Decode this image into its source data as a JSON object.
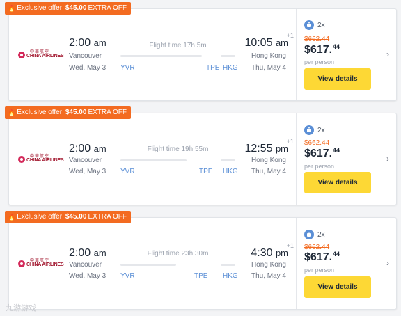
{
  "cards": [
    {
      "badge": {
        "prefix": "Exclusive offer!",
        "amount": "$45.00",
        "suffix": "EXTRA OFF"
      },
      "airline": {
        "name_en": "CHINA AIRLINES",
        "name_cn": "中華航空"
      },
      "depart": {
        "time": "2:00",
        "ampm": "am",
        "city": "Vancouver",
        "date": "Wed, May 3",
        "code": "YVR"
      },
      "flight_time": "Flight time 17h 5m",
      "stop_code": "TPE",
      "arrive": {
        "time": "10:05",
        "ampm": "am",
        "plus": "+1",
        "city": "Hong Kong",
        "date": "Thu, May 4",
        "code": "HKG"
      },
      "bags": "2x",
      "old_price": "$662.44",
      "price_main": "$617.",
      "price_cents": "44",
      "per": "per person",
      "button": "View details"
    },
    {
      "badge": {
        "prefix": "Exclusive offer!",
        "amount": "$45.00",
        "suffix": "EXTRA OFF"
      },
      "airline": {
        "name_en": "CHINA AIRLINES",
        "name_cn": "中華航空"
      },
      "depart": {
        "time": "2:00",
        "ampm": "am",
        "city": "Vancouver",
        "date": "Wed, May 3",
        "code": "YVR"
      },
      "flight_time": "Flight time 19h 55m",
      "stop_code": "TPE",
      "arrive": {
        "time": "12:55",
        "ampm": "pm",
        "plus": "+1",
        "city": "Hong Kong",
        "date": "Thu, May 4",
        "code": "HKG"
      },
      "bags": "2x",
      "old_price": "$662.44",
      "price_main": "$617.",
      "price_cents": "44",
      "per": "per person",
      "button": "View details"
    },
    {
      "badge": {
        "prefix": "Exclusive offer!",
        "amount": "$45.00",
        "suffix": "EXTRA OFF"
      },
      "airline": {
        "name_en": "CHINA AIRLINES",
        "name_cn": "中華航空"
      },
      "depart": {
        "time": "2:00",
        "ampm": "am",
        "city": "Vancouver",
        "date": "Wed, May 3",
        "code": "YVR"
      },
      "flight_time": "Flight time 23h 30m",
      "stop_code": "TPE",
      "arrive": {
        "time": "4:30",
        "ampm": "pm",
        "plus": "+1",
        "city": "Hong Kong",
        "date": "Thu, May 4",
        "code": "HKG"
      },
      "bags": "2x",
      "old_price": "$662.44",
      "price_main": "$617.",
      "price_cents": "44",
      "per": "per person",
      "button": "View details"
    }
  ],
  "watermark": "九游游戏",
  "colors": {
    "badge": "#f36b21",
    "button": "#fdd835",
    "code": "#5b8fd6",
    "old_price": "#f36b21"
  }
}
